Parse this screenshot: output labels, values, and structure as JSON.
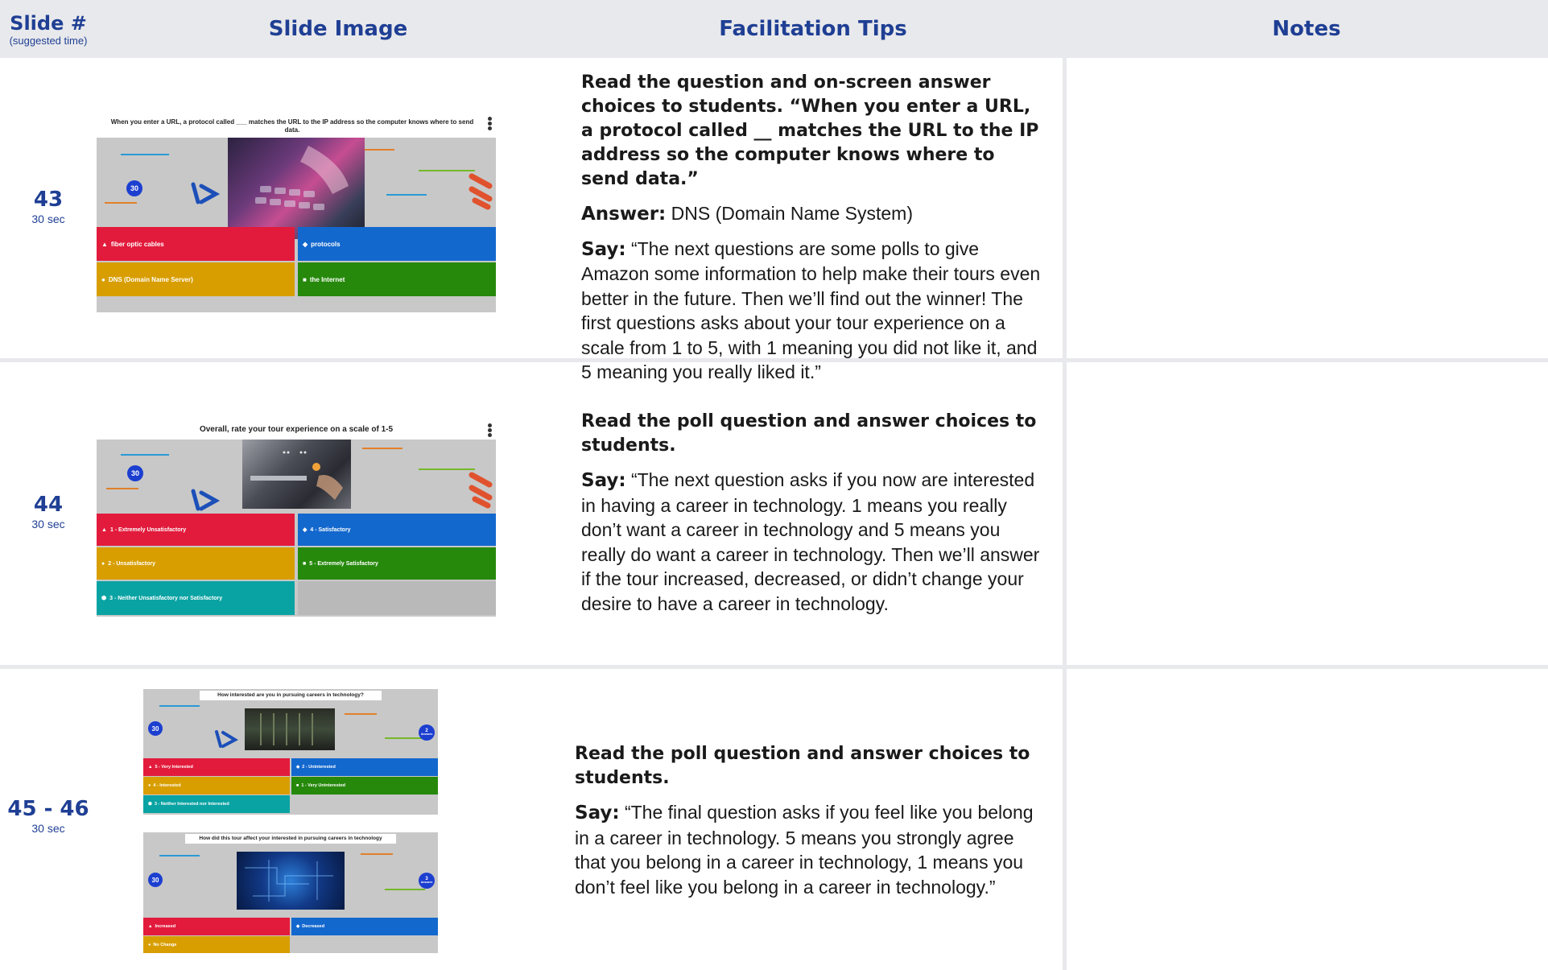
{
  "header": {
    "slide_num": "Slide #",
    "suggested_time": "(suggested time)",
    "slide_image": "Slide Image",
    "facilitation_tips": "Facilitation Tips",
    "notes": "Notes"
  },
  "rows": [
    {
      "slide": "43",
      "time": "30 sec",
      "thumb": {
        "question": "When you enter a URL, a protocol called ___ matches the URL to the IP address so the computer knows where to send data.",
        "timer": "30",
        "answers": [
          "fiber optic cables",
          "protocols",
          "DNS (Domain Name Server)",
          "the Internet"
        ]
      },
      "tips": {
        "lead": "Read the question and on-screen answer choices to students. “When you enter a URL, a protocol called __ matches the URL to the IP address so the computer knows where to send data.”",
        "answer_label": "Answer:",
        "answer_text": " DNS (Domain Name System)",
        "say_label": "Say:",
        "say_text": " “The next questions are some polls to give Amazon some information to help make their tours even better in the future. Then we’ll find out the winner! The first questions asks about your tour experience on a scale from 1 to 5, with 1 meaning you did not like it, and 5 meaning you really liked it.”"
      }
    },
    {
      "slide": "44",
      "time": "30 sec",
      "thumb": {
        "question_pre": "Overall, rate your ",
        "question_bold": "tour experience",
        "question_post": " on a scale of 1-5",
        "timer": "30",
        "answers": [
          "1 - Extremely Unsatisfactory",
          "4 - Satisfactory",
          "2 - Unsatisfactory",
          "5 - Extremely Satisfactory",
          "3 - Neither Unsatisfactory nor Satisfactory"
        ]
      },
      "tips": {
        "lead": "Read the poll question and answer choices to students.",
        "say_label": "Say:",
        "say_text": " “The next question asks if you now are interested in having a career in technology. 1 means you really don’t want a career in technology and 5 means you really do want a career in technology. Then we’ll answer if the tour increased, decreased, or didn’t change your desire to have a career in technology."
      }
    },
    {
      "slide": "45 - 46",
      "time": "30 sec",
      "thumb_a": {
        "question": "How interested are you in pursuing careers in technology?",
        "timer": "30",
        "badge_num": "2",
        "badge_label": "Answers",
        "answers": [
          "5 - Very Interested",
          "2 - Uninterested",
          "4 - Interested",
          "1 - Very Uninterested",
          "3 - Neither Interested nor Interested"
        ]
      },
      "thumb_b": {
        "question": "How did this tour affect your interested in pursuing careers in technology",
        "timer": "30",
        "badge_num": "3",
        "badge_label": "Answers",
        "answers": [
          "Increased",
          "Decreased",
          "No Change"
        ]
      },
      "tips": {
        "lead": "Read the poll question and answer choices to students.",
        "say_label": "Say:",
        "say_text": " “The final question asks if you feel like you belong in a career in technology. 5 means you strongly agree that you belong in a career in technology, 1 means you don’t feel like you belong in a career in technology.”"
      }
    }
  ],
  "colors": {
    "header_bg": "#e8e9ec",
    "header_text": "#1f3f94",
    "answer_red": "#e21b3c",
    "answer_blue": "#1368ce",
    "answer_yellow": "#d89e00",
    "answer_green": "#26890c",
    "answer_teal": "#0aa3a3"
  },
  "icons": [
    "triangle-icon",
    "diamond-icon",
    "circle-icon",
    "square-icon",
    "kebab-menu-icon",
    "amazon-logo-icon"
  ]
}
